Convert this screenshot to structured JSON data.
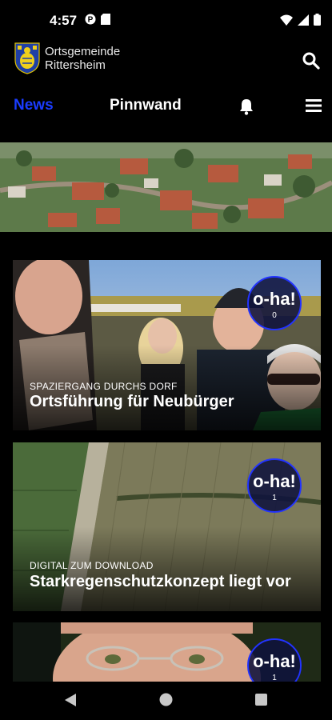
{
  "status": {
    "time": "4:57"
  },
  "brand": {
    "line1": "Ortsgemeinde",
    "line2": "Rittersheim"
  },
  "tabs": {
    "news": "News",
    "pinnwand": "Pinnwand"
  },
  "cards": [
    {
      "kicker": "SPAZIERGANG DURCHS DORF",
      "title": "Ortsführung für Neubürger",
      "badge": "o-ha!",
      "count": "0"
    },
    {
      "kicker": "DIGITAL ZUM DOWNLOAD",
      "title": "Starkregenschutzkonzept liegt vor",
      "badge": "o-ha!",
      "count": "1"
    },
    {
      "kicker": "",
      "title": "",
      "badge": "o-ha!",
      "count": "1"
    }
  ],
  "colors": {
    "accent": "#1a3cff",
    "background": "#000000"
  }
}
